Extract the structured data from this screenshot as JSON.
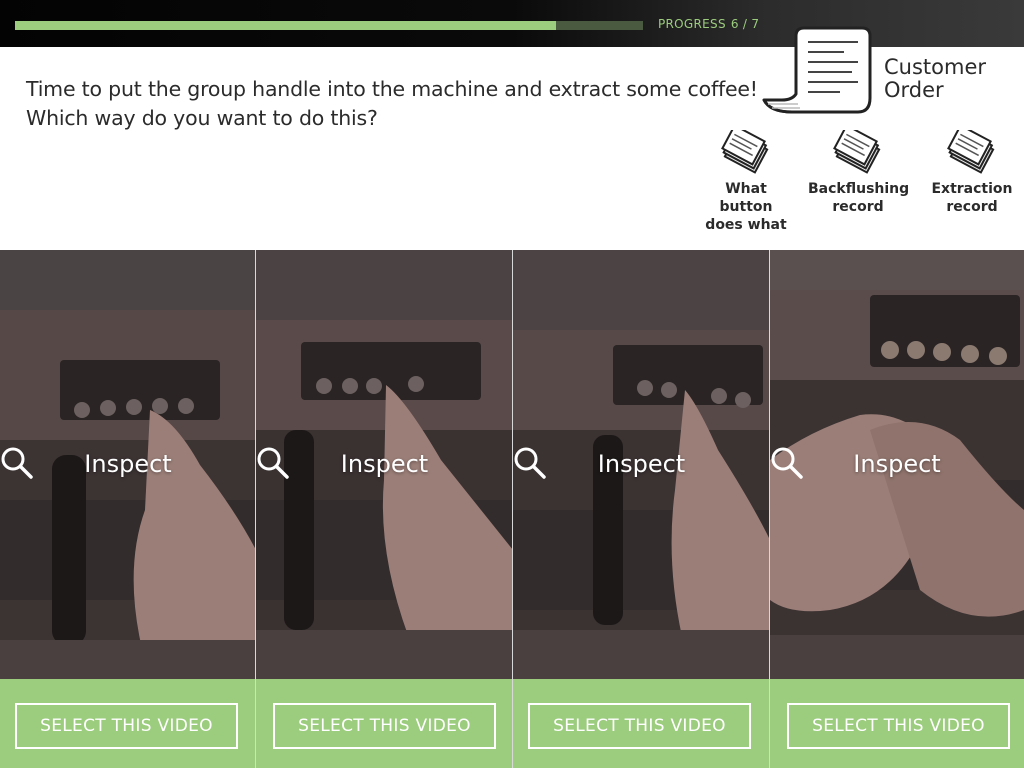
{
  "progress": {
    "label": "PROGRESS",
    "count": "6 / 7",
    "fraction": 0.861,
    "fill_color": "#9ccc7e"
  },
  "question": {
    "line1": "Time to put the group handle into the machine and extract some coffee!",
    "line2": "Which way do you want to do this?"
  },
  "customer_order": {
    "icon": "receipt-icon",
    "label_line1": "Customer",
    "label_line2": "Order"
  },
  "resources": [
    {
      "icon": "document-stack-icon",
      "lines": [
        "What",
        "button",
        "does what"
      ]
    },
    {
      "icon": "document-stack-icon",
      "lines": [
        "Backflushing",
        "record"
      ]
    },
    {
      "icon": "document-stack-icon",
      "lines": [
        "Extraction",
        "record"
      ]
    }
  ],
  "videos": [
    {
      "inspect_label": "Inspect",
      "select_label": "SELECT THIS VIDEO"
    },
    {
      "inspect_label": "Inspect",
      "select_label": "SELECT THIS VIDEO"
    },
    {
      "inspect_label": "Inspect",
      "select_label": "SELECT THIS VIDEO"
    },
    {
      "inspect_label": "Inspect",
      "select_label": "SELECT THIS VIDEO"
    }
  ],
  "colors": {
    "accent_green": "#9ccc7e",
    "text_dark": "#2b2b2b"
  }
}
